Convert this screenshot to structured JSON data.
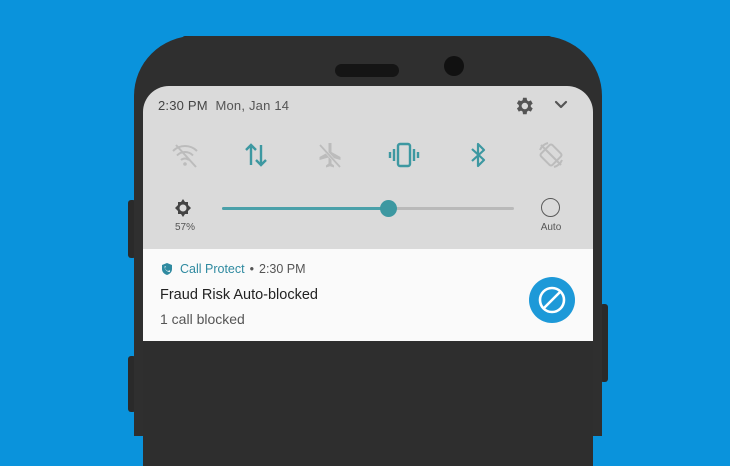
{
  "status_bar": {
    "time": "2:30 PM",
    "date": "Mon, Jan 14"
  },
  "quick_settings": {
    "tiles": [
      {
        "icon": "wifi-off-icon",
        "active": false
      },
      {
        "icon": "data-transfer-icon",
        "active": true
      },
      {
        "icon": "airplane-mode-icon",
        "active": false
      },
      {
        "icon": "vibrate-icon",
        "active": true
      },
      {
        "icon": "bluetooth-icon",
        "active": true
      },
      {
        "icon": "rotation-lock-icon",
        "active": false
      }
    ],
    "active_color": "#3d98a1",
    "inactive_color": "#bcbcbc"
  },
  "brightness": {
    "percent_label": "57%",
    "level": 0.57,
    "auto_label": "Auto"
  },
  "notification": {
    "app_name": "Call Protect",
    "time": "2:30 PM",
    "separator": "•",
    "title": "Fraud Risk Auto-blocked",
    "body": "1 call blocked",
    "action_icon": "block-icon",
    "action_color": "#1d99d8"
  },
  "colors": {
    "background": "#0a93dc",
    "accent": "#3d98a1"
  }
}
